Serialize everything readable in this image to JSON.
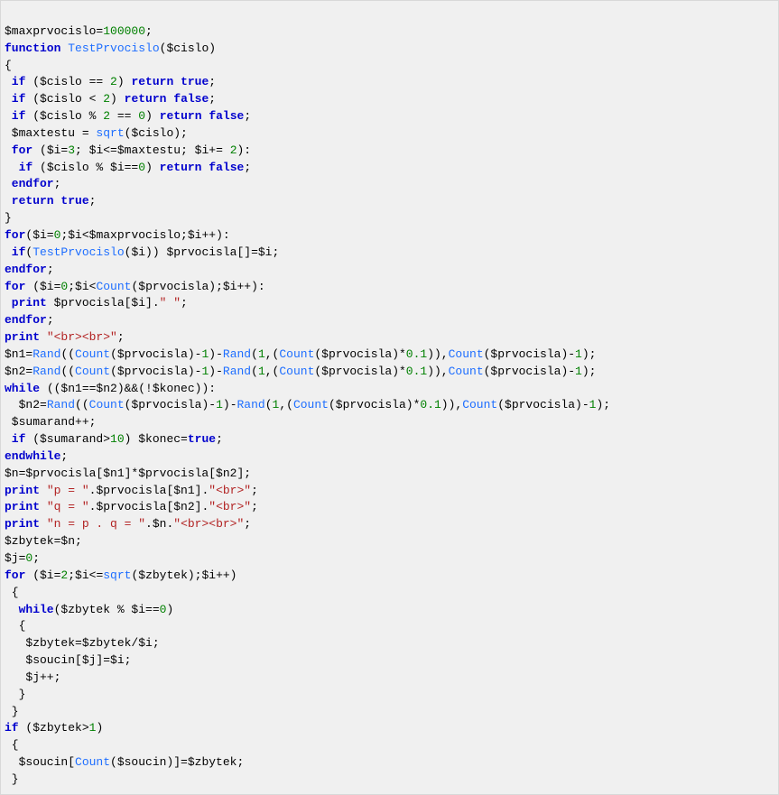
{
  "code": {
    "l01": {
      "a": "$maxprvocislo=",
      "b": "100000",
      "c": ";"
    },
    "l02": {
      "a": "function",
      "b": " TestPrvocislo",
      "c": "($cislo)"
    },
    "l03": "{",
    "l04": {
      "a": " if",
      "b": " ($cislo == ",
      "c": "2",
      "d": ") ",
      "e": "return",
      "f": " ",
      "g": "true",
      "h": ";"
    },
    "l05": {
      "a": " if",
      "b": " ($cislo < ",
      "c": "2",
      "d": ") ",
      "e": "return",
      "f": " ",
      "g": "false",
      "h": ";"
    },
    "l06": {
      "a": " if",
      "b": " ($cislo % ",
      "c": "2",
      "d": " == ",
      "e": "0",
      "f": ") ",
      "g": "return",
      "h": " ",
      "i": "false",
      "j": ";"
    },
    "l07": {
      "a": " $maxtestu = ",
      "b": "sqrt",
      "c": "($cislo);"
    },
    "l08": {
      "a": " for",
      "b": " ($i=",
      "c": "3",
      "d": "; $i<=$maxtestu; $i+= ",
      "e": "2",
      "f": "):"
    },
    "l09": {
      "a": "  if",
      "b": " ($cislo % $i==",
      "c": "0",
      "d": ") ",
      "e": "return",
      "f": " ",
      "g": "false",
      "h": ";"
    },
    "l10": {
      "a": " endfor",
      "b": ";"
    },
    "l11": {
      "a": " return",
      "b": " ",
      "c": "true",
      "d": ";"
    },
    "l12": "}",
    "l13": {
      "a": "for",
      "b": "($i=",
      "c": "0",
      "d": ";$i<$maxprvocislo;$i++):"
    },
    "l14": {
      "a": " if",
      "b": "(",
      "c": "TestPrvocislo",
      "d": "($i)) $prvocisla[]=$i;"
    },
    "l15": {
      "a": "endfor",
      "b": ";"
    },
    "l16": {
      "a": "for",
      "b": " ($i=",
      "c": "0",
      "d": ";$i<",
      "e": "Count",
      "f": "($prvocisla);$i++):"
    },
    "l17": {
      "a": " print",
      "b": " $prvocisla[$i].",
      "c": "\" \"",
      "d": ";"
    },
    "l18": {
      "a": "endfor",
      "b": ";"
    },
    "l19": {
      "a": "print",
      "b": " ",
      "c": "\"<br><br>\"",
      "d": ";"
    },
    "l20": {
      "a": "$n1=",
      "b": "Rand",
      "c": "((",
      "d": "Count",
      "e": "($prvocisla)-",
      "f": "1",
      "g": ")-",
      "h": "Rand",
      "i": "(",
      "j": "1",
      "k": ",(",
      "l": "Count",
      "m": "($prvocisla)*",
      "n": "0.1",
      "o": ")),",
      "p": "Count",
      "q": "($prvocisla)-",
      "r": "1",
      "s": ");"
    },
    "l21": {
      "a": "$n2=",
      "b": "Rand",
      "c": "((",
      "d": "Count",
      "e": "($prvocisla)-",
      "f": "1",
      "g": ")-",
      "h": "Rand",
      "i": "(",
      "j": "1",
      "k": ",(",
      "l": "Count",
      "m": "($prvocisla)*",
      "n": "0.1",
      "o": ")),",
      "p": "Count",
      "q": "($prvocisla)-",
      "r": "1",
      "s": ");"
    },
    "l22": {
      "a": "while",
      "b": " (($n1==$n2)&&(!$konec)):"
    },
    "l23": {
      "a": "  $n2=",
      "b": "Rand",
      "c": "((",
      "d": "Count",
      "e": "($prvocisla)-",
      "f": "1",
      "g": ")-",
      "h": "Rand",
      "i": "(",
      "j": "1",
      "k": ",(",
      "l": "Count",
      "m": "($prvocisla)*",
      "n": "0.1",
      "o": ")),",
      "p": "Count",
      "q": "($prvocisla)-",
      "r": "1",
      "s": ");"
    },
    "l24": " $sumarand++;",
    "l25": {
      "a": " if",
      "b": " ($sumarand>",
      "c": "10",
      "d": ") $konec=",
      "e": "true",
      "f": ";"
    },
    "l26": {
      "a": "endwhile",
      "b": ";"
    },
    "l27": "$n=$prvocisla[$n1]*$prvocisla[$n2];",
    "l28": {
      "a": "print",
      "b": " ",
      "c": "\"p = \"",
      "d": ".$prvocisla[$n1].",
      "e": "\"<br>\"",
      "f": ";"
    },
    "l29": {
      "a": "print",
      "b": " ",
      "c": "\"q = \"",
      "d": ".$prvocisla[$n2].",
      "e": "\"<br>\"",
      "f": ";"
    },
    "l30": {
      "a": "print",
      "b": " ",
      "c": "\"n = p . q = \"",
      "d": ".$n.",
      "e": "\"<br><br>\"",
      "f": ";"
    },
    "l31": "$zbytek=$n;",
    "l32": {
      "a": "$j=",
      "b": "0",
      "c": ";"
    },
    "l33": {
      "a": "for",
      "b": " ($i=",
      "c": "2",
      "d": ";$i<=",
      "e": "sqrt",
      "f": "($zbytek);$i++)"
    },
    "l34": " {",
    "l35": {
      "a": "  while",
      "b": "($zbytek % $i==",
      "c": "0",
      "d": ")"
    },
    "l36": "  {",
    "l37": "   $zbytek=$zbytek/$i;",
    "l38": "   $soucin[$j]=$i;",
    "l39": "   $j++;",
    "l40": "  }",
    "l41": " }",
    "l42": {
      "a": "if",
      "b": " ($zbytek>",
      "c": "1",
      "d": ")"
    },
    "l43": " {",
    "l44": {
      "a": "  $soucin[",
      "b": "Count",
      "c": "($soucin)]=$zbytek;"
    },
    "l45": " }"
  }
}
